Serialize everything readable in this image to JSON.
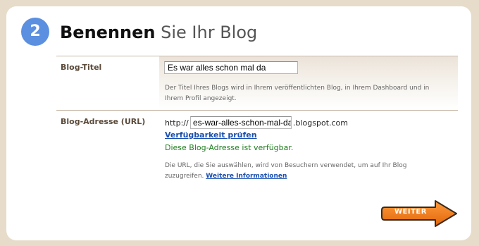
{
  "step": {
    "number": "2",
    "title_bold": "Benennen",
    "title_light": "Sie Ihr Blog"
  },
  "blog_title": {
    "label": "Blog-Titel",
    "value": "Es war alles schon mal da",
    "help_line1": "Der Titel Ihres Blogs wird in Ihrem veröffentlichten Blog, in Ihrem Dashboard und in",
    "help_line2": "Ihrem Profil angezeigt."
  },
  "blog_address": {
    "label": "Blog-Adresse (URL)",
    "prefix": "http://",
    "value": "es-war-alles-schon-mal-da",
    "suffix": ".blogspot.com",
    "check_link": "Verfügbarkeit prüfen",
    "available_text": "Diese Blog-Adresse ist verfügbar.",
    "help_line1": "Die URL, die Sie auswählen, wird von Besuchern verwendet, um auf Ihr Blog",
    "help_line2": "zuzugreifen.",
    "more_info_link": "Weitere Informationen"
  },
  "next_button": {
    "label": "WEITER"
  },
  "colors": {
    "background": "#e6dcc9",
    "step_circle": "#5b8fe0",
    "link": "#1a4fb0",
    "available": "#1e7d1e",
    "button_orange": "#f07a1a"
  },
  "icons": {
    "next_button_shape": "arrow-right-icon"
  }
}
